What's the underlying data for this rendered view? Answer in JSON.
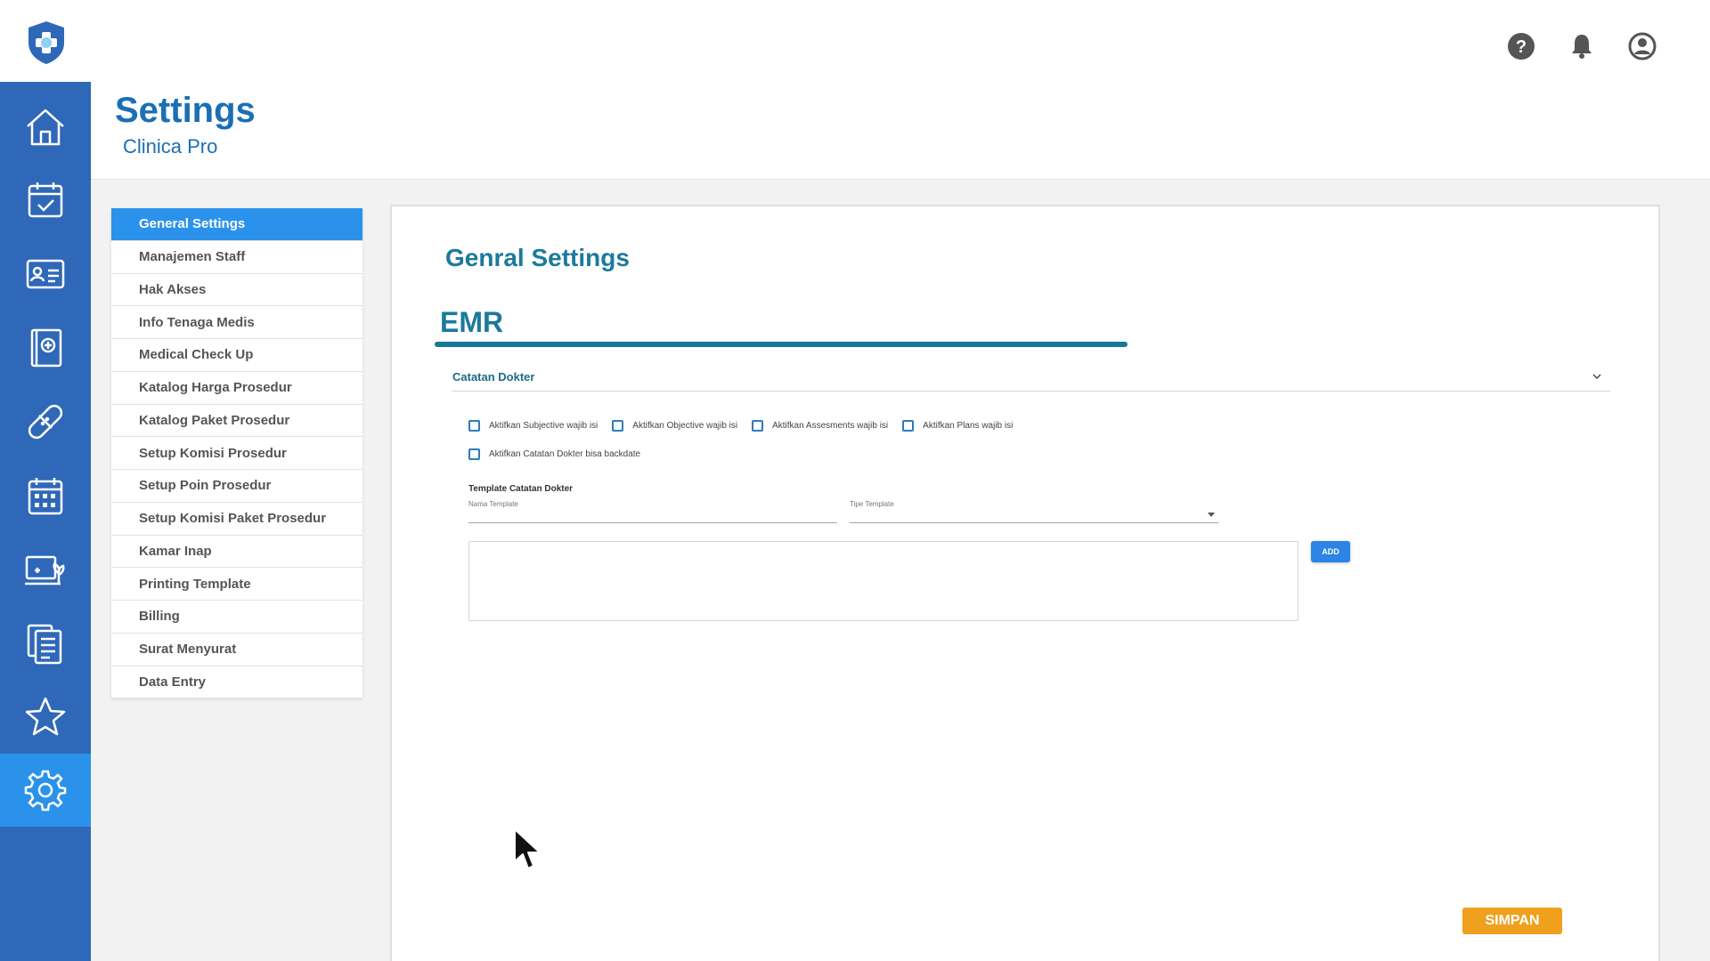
{
  "app": {
    "logo_icon": "shield-cross-logo",
    "accent": "#2b92eb",
    "sidebar_bg": "#2f68b8",
    "primary_text": "#1a6fb5"
  },
  "topbar": {
    "icons": [
      "help-icon",
      "bell-icon",
      "user-account-icon"
    ]
  },
  "sidebar": {
    "items": [
      {
        "icon": "home-icon"
      },
      {
        "icon": "calendar-check-icon"
      },
      {
        "icon": "patient-card-icon"
      },
      {
        "icon": "medical-record-icon"
      },
      {
        "icon": "bandage-icon"
      },
      {
        "icon": "schedule-grid-icon"
      },
      {
        "icon": "monitor-plant-icon"
      },
      {
        "icon": "documents-icon"
      },
      {
        "icon": "star-icon"
      },
      {
        "icon": "gear-icon",
        "active": true
      }
    ]
  },
  "header": {
    "title": "Settings",
    "subtitle": "Clinica Pro"
  },
  "settings_menu": {
    "items": [
      {
        "label": "General Settings",
        "active": true
      },
      {
        "label": "Manajemen Staff"
      },
      {
        "label": "Hak Akses"
      },
      {
        "label": "Info Tenaga Medis"
      },
      {
        "label": "Medical Check Up"
      },
      {
        "label": "Katalog Harga Prosedur"
      },
      {
        "label": "Katalog Paket Prosedur"
      },
      {
        "label": "Setup Komisi Prosedur"
      },
      {
        "label": "Setup Poin Prosedur"
      },
      {
        "label": "Setup Komisi Paket Prosedur"
      },
      {
        "label": "Kamar Inap"
      },
      {
        "label": "Printing Template"
      },
      {
        "label": "Billing"
      },
      {
        "label": "Surat Menyurat"
      },
      {
        "label": "Data Entry"
      }
    ]
  },
  "main": {
    "title": "Genral Settings",
    "section_tab": "EMR",
    "accordion_label": "Catatan Dokter",
    "checkboxes_row1": [
      {
        "label": "Aktifkan Subjective wajib isi",
        "checked": false
      },
      {
        "label": "Aktifkan Objective wajib isi",
        "checked": false
      },
      {
        "label": "Aktifkan Assesments wajib isi",
        "checked": false
      },
      {
        "label": "Aktifkan Plans wajib isi",
        "checked": false
      }
    ],
    "checkboxes_row2": [
      {
        "label": "Aktifkan Catatan Dokter bisa backdate",
        "checked": false
      }
    ],
    "template_heading": "Template Catatan Dokter",
    "nama_template_label": "Nama Template",
    "nama_template_value": "",
    "tipe_template_label": "Tipe Template",
    "tipe_template_value": "",
    "template_body": "",
    "add_label": "ADD",
    "save_label": "SIMPAN"
  }
}
